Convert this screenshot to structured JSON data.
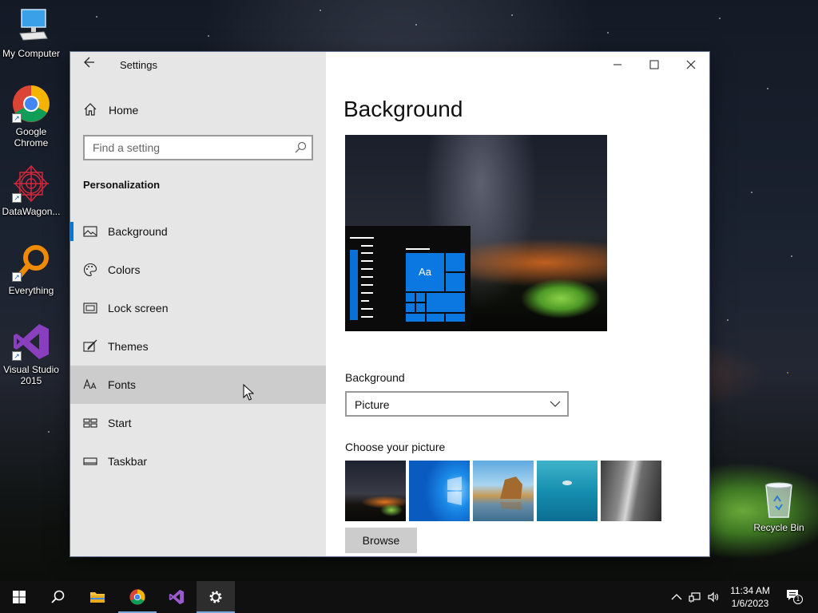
{
  "desktop": {
    "icons": [
      {
        "label": "My Computer"
      },
      {
        "label": "Google Chrome"
      },
      {
        "label": "DataWagon..."
      },
      {
        "label": "Everything"
      },
      {
        "label": "Visual Studio 2015"
      },
      {
        "label": "Recycle Bin"
      }
    ]
  },
  "window": {
    "title": "Settings",
    "sidebar": {
      "home_label": "Home",
      "search_placeholder": "Find a setting",
      "section_title": "Personalization",
      "items": [
        {
          "label": "Background",
          "icon": "image-icon",
          "selected": true
        },
        {
          "label": "Colors",
          "icon": "palette-icon"
        },
        {
          "label": "Lock screen",
          "icon": "lock-screen-icon"
        },
        {
          "label": "Themes",
          "icon": "themes-brush-icon"
        },
        {
          "label": "Fonts",
          "icon": "fonts-icon",
          "hovered": true
        },
        {
          "label": "Start",
          "icon": "start-tiles-icon"
        },
        {
          "label": "Taskbar",
          "icon": "taskbar-icon"
        }
      ]
    },
    "content": {
      "page_title": "Background",
      "preview_tile_text": "Aa",
      "background_label": "Background",
      "background_value": "Picture",
      "choose_picture_label": "Choose your picture",
      "browse_label": "Browse"
    }
  },
  "taskbar": {
    "time": "11:34 AM",
    "date": "1/6/2023",
    "notification_count": "1"
  },
  "colors": {
    "accent": "#0078d7",
    "sidebar_bg": "#e6e6e6",
    "hover_bg": "#cccccc",
    "taskbar_bg": "#101010"
  }
}
